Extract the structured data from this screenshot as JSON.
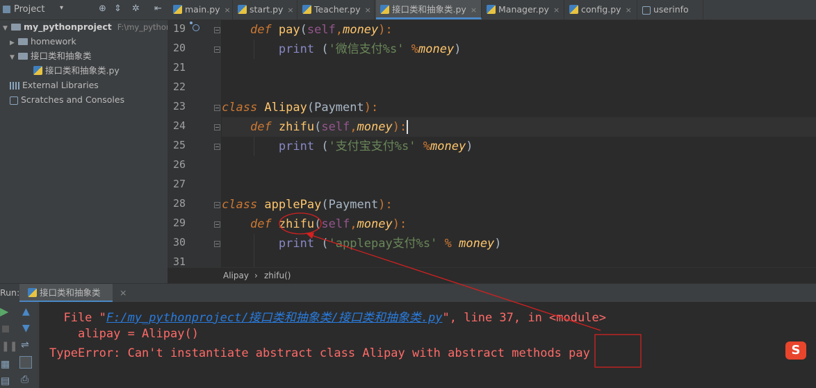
{
  "project": {
    "title": "Project",
    "root": {
      "name": "my_pythonproject",
      "path": "F:\\my_pythonpro"
    },
    "items": [
      {
        "label": "homework"
      },
      {
        "label": "接口类和抽象类"
      },
      {
        "label": "接口类和抽象类.py"
      },
      {
        "label": "External Libraries"
      },
      {
        "label": "Scratches and Consoles"
      }
    ]
  },
  "tabs": [
    {
      "label": "main.py"
    },
    {
      "label": "start.py"
    },
    {
      "label": "Teacher.py"
    },
    {
      "label": "接口类和抽象类.py"
    },
    {
      "label": "Manager.py"
    },
    {
      "label": "config.py"
    },
    {
      "label": "userinfo"
    }
  ],
  "editor": {
    "line_numbers": [
      "19",
      "20",
      "21",
      "22",
      "23",
      "24",
      "25",
      "26",
      "27",
      "28",
      "29",
      "30",
      "31"
    ],
    "code": {
      "l19": {
        "kw": "def",
        "fn": "pay",
        "open": "(",
        "self": "self",
        "comma": ",",
        "param": "money",
        "close": "):"
      },
      "l20": {
        "fn": "print",
        "sp": " (",
        "str": "'微信支付%s'",
        "op": " %",
        "var": "money",
        "close": ")"
      },
      "l23": {
        "kw": "class",
        "name": " Alipay",
        "open": "(",
        "base": "Payment",
        "close": "):"
      },
      "l24": {
        "kw": "def",
        "fn": "zhifu",
        "open": "(",
        "self": "self",
        "comma": ",",
        "param": "money",
        "close": "):"
      },
      "l25": {
        "fn": "print",
        "sp": " (",
        "str": "'支付宝支付%s'",
        "op": " %",
        "var": "money",
        "close": ")"
      },
      "l28": {
        "kw": "class",
        "name": " applePay",
        "open": "(",
        "base": "Payment",
        "close": "):"
      },
      "l29": {
        "kw": "def",
        "fn": "zhifu",
        "open": "(",
        "self": "self",
        "comma": ",",
        "param": "money",
        "close": "):"
      },
      "l30": {
        "fn": "print",
        "sp": " (",
        "str": "'applepay支付%s'",
        "op": " % ",
        "var": "money",
        "close": ")"
      }
    }
  },
  "breadcrumb": {
    "class": "Alipay",
    "sep": "›",
    "method": "zhifu()"
  },
  "run": {
    "label": "Run:",
    "tab": "接口类和抽象类",
    "console": {
      "line1_pre": "  File \"",
      "line1_link": "F:/my_pythonproject/接口类和抽象类/接口类和抽象类.py",
      "line1_post": "\", line 37, in <module>",
      "line2": "    alipay = Alipay()",
      "line3": "TypeError: Can't instantiate abstract class Alipay with abstract methods pay"
    }
  },
  "colors": {
    "annotation": "#d42020",
    "keyword": "#cc7832",
    "function": "#ffc66d",
    "string": "#6a8759"
  }
}
